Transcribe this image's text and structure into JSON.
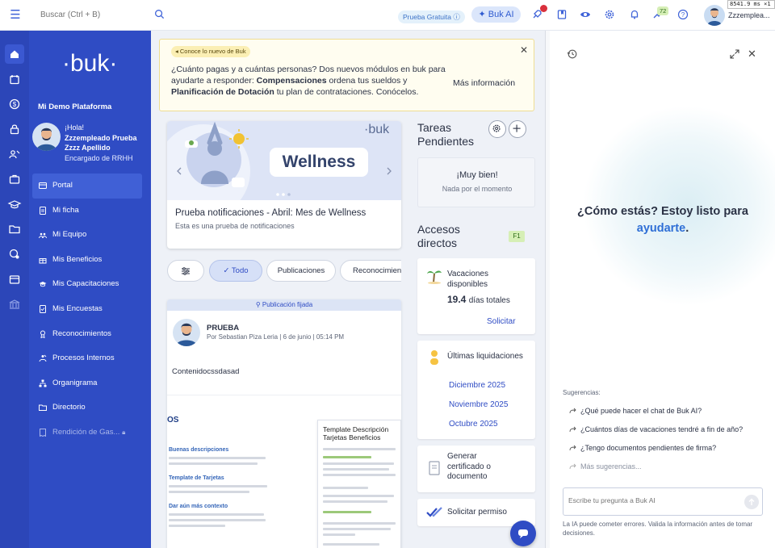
{
  "topbar": {
    "search_placeholder": "Buscar (Ctrl + B)",
    "trial_label": "Prueba Gratuita",
    "bukai_label": "Buk AI",
    "notifications_badge": "72",
    "username": "Zzzemplea...",
    "perf_overlay": "8541.9 ms ×1"
  },
  "sidebar": {
    "logo": "·buk·",
    "platform": "Mi Demo Plataforma",
    "user": {
      "greeting": "¡Hola!",
      "name": "Zzzempleado Prueba Zzzz Apellido",
      "role": "Encargado de RRHH"
    },
    "items": [
      {
        "label": "Portal",
        "icon": "portal-icon",
        "active": true
      },
      {
        "label": "Mi ficha",
        "icon": "file-icon"
      },
      {
        "label": "Mi Equipo",
        "icon": "team-icon"
      },
      {
        "label": "Mis Beneficios",
        "icon": "gift-icon"
      },
      {
        "label": "Mis Capacitaciones",
        "icon": "graduation-icon"
      },
      {
        "label": "Mis Encuestas",
        "icon": "survey-icon"
      },
      {
        "label": "Reconocimientos",
        "icon": "medal-icon"
      },
      {
        "label": "Procesos Internos",
        "icon": "process-icon"
      },
      {
        "label": "Organigrama",
        "icon": "org-icon"
      },
      {
        "label": "Directorio",
        "icon": "folder-icon"
      },
      {
        "label": "Rendición de Gas...",
        "icon": "receipt-icon",
        "disabled": true
      }
    ]
  },
  "banner": {
    "tag": "Conoce lo nuevo de Buk",
    "text_1": "¿Cuánto pagas y a cuántas personas? Dos nuevos módulos en buk para ayudarte a responder: ",
    "bold_1": "Compensaciones",
    "text_2": " ordena tus sueldos y ",
    "bold_2": "Planificación de Dotación",
    "text_3": " tu plan de contrataciones. Conócelos.",
    "more": "Más información"
  },
  "wellness": {
    "image_word": "Wellness",
    "image_logo": "·buk",
    "title": "Prueba notificaciones - Abril: Mes de Wellness",
    "subtitle": "Esta es una prueba de notificaciones"
  },
  "filters": {
    "items": [
      "Todo",
      "Publicaciones",
      "Reconocimientos"
    ]
  },
  "post": {
    "pinned": "Publicación fijada",
    "author": "PRUEBA",
    "meta_by": "Por Sebastian Piza Leria",
    "meta_date": "6 de junio",
    "meta_time": "05:14 PM",
    "body": "Contenidocssdasad",
    "doc": {
      "heading": "OS",
      "sec1": "Buenas descripciones",
      "sec2": "Template de Tarjetas",
      "sec3": "Dar aún más contexto",
      "card_title": "Template Descripción Tarjetas Beneficios"
    }
  },
  "tareas": {
    "title": "Tareas Pendientes",
    "ok": "¡Muy bien!",
    "empty": "Nada por el momento"
  },
  "accesos": {
    "title": "Accesos directos",
    "shortcut": "F1",
    "vacaciones_label": "Vacaciones disponibles",
    "vacaciones_value": "19.4",
    "vacaciones_unit": "días totales",
    "solicitar": "Solicitar",
    "liquidaciones_label": "Últimas liquidaciones",
    "liquidaciones": [
      "Diciembre 2025",
      "Noviembre 2025",
      "Octubre 2025"
    ],
    "certificado": "Generar certificado o documento",
    "permiso": "Solicitar permiso"
  },
  "chat": {
    "greeting_1": "¿Cómo estás? Estoy listo para",
    "greeting_2": "ayudarte",
    "greeting_3": ".",
    "suggestions_title": "Sugerencias:",
    "suggestions": [
      "¿Qué puede hacer el chat de Buk AI?",
      "¿Cuántos días de vacaciones tendré a fin de año?",
      "¿Tengo documentos pendientes de firma?"
    ],
    "more_suggestions": "Más sugerencias...",
    "input_placeholder": "Escribe tu pregunta a Buk AI",
    "disclaimer": "La IA puede cometer errores. Valida la información antes de tomar decisiones."
  },
  "colors": {
    "sidebar": "#2f4cc4",
    "rail": "#2c46b8",
    "accent": "#2f6fd6",
    "badge_green": "#d6efb6"
  }
}
